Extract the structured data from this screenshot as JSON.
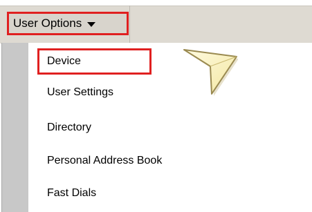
{
  "menu": {
    "title": "User Options",
    "caret_icon": "caret-down-icon"
  },
  "dropdown": {
    "items": [
      {
        "label": "Device"
      },
      {
        "label": "User Settings"
      },
      {
        "label": "Directory"
      },
      {
        "label": "Personal Address Book"
      },
      {
        "label": "Fast Dials"
      }
    ]
  },
  "annotation": {
    "pointer_icon": "pointer-arrow-icon",
    "highlight_color": "#e02020",
    "pointer_fill": "#fff9c4",
    "pointer_stroke": "#9a8a50"
  }
}
